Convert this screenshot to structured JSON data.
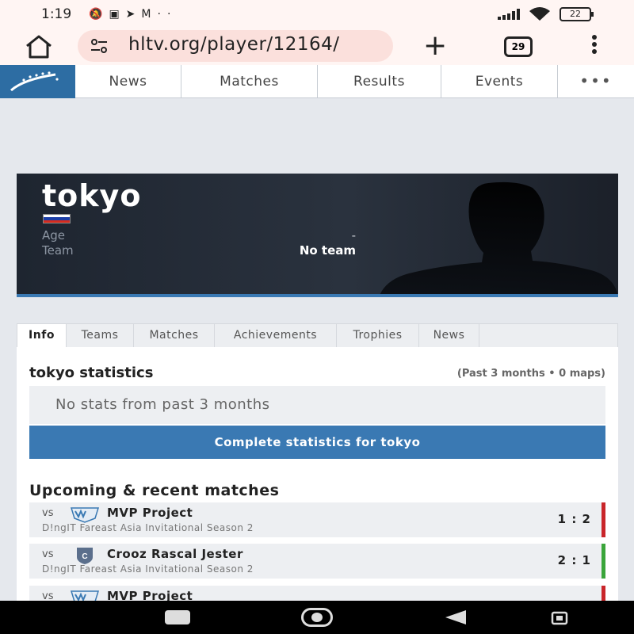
{
  "status_bar": {
    "time": "1:19",
    "notification_icons": [
      "muted-bell-icon",
      "twitch-icon",
      "telegram-icon",
      "gmail-icon",
      "more-dots-icon"
    ],
    "battery": "22"
  },
  "browser": {
    "url": "hltv.org/player/12164/",
    "tab_count": "29"
  },
  "nav": {
    "items": [
      {
        "label": "News"
      },
      {
        "label": "Matches"
      },
      {
        "label": "Results"
      },
      {
        "label": "Events"
      }
    ],
    "more": "•••"
  },
  "player": {
    "nickname": "tokyo",
    "age_label": "Age",
    "age_value": "-",
    "team_label": "Team",
    "team_value": "No team",
    "flag_colors": [
      "#ffffff",
      "#1c3fa8",
      "#d52b1e"
    ]
  },
  "tabs": [
    {
      "label": "Info"
    },
    {
      "label": "Teams"
    },
    {
      "label": "Matches"
    },
    {
      "label": "Achievements"
    },
    {
      "label": "Trophies"
    },
    {
      "label": "News"
    }
  ],
  "stats": {
    "title": "tokyo statistics",
    "period": "(Past 3 months • 0 maps)",
    "empty_text": "No stats from past 3 months",
    "button_label": "Complete statistics for tokyo"
  },
  "matches": {
    "title": "Upcoming & recent matches",
    "items": [
      {
        "vs": "vs",
        "team": "MVP Project",
        "logo": "mvp-logo",
        "event": "D!ngIT Fareast Asia Invitational Season 2",
        "score": "1 : 2",
        "result_color": "#c9252a"
      },
      {
        "vs": "vs",
        "team": "Crooz Rascal Jester",
        "logo": "crooz-logo",
        "event": "D!ngIT Fareast Asia Invitational Season 2",
        "score": "2 : 1",
        "result_color": "#3aa53a"
      },
      {
        "vs": "vs",
        "team": "MVP Project",
        "logo": "mvp-logo",
        "event": "",
        "score": "",
        "result_color": "#c9252a"
      }
    ]
  },
  "colors": {
    "accent": "#3a79b3",
    "loss": "#c9252a",
    "win": "#3aa53a"
  }
}
